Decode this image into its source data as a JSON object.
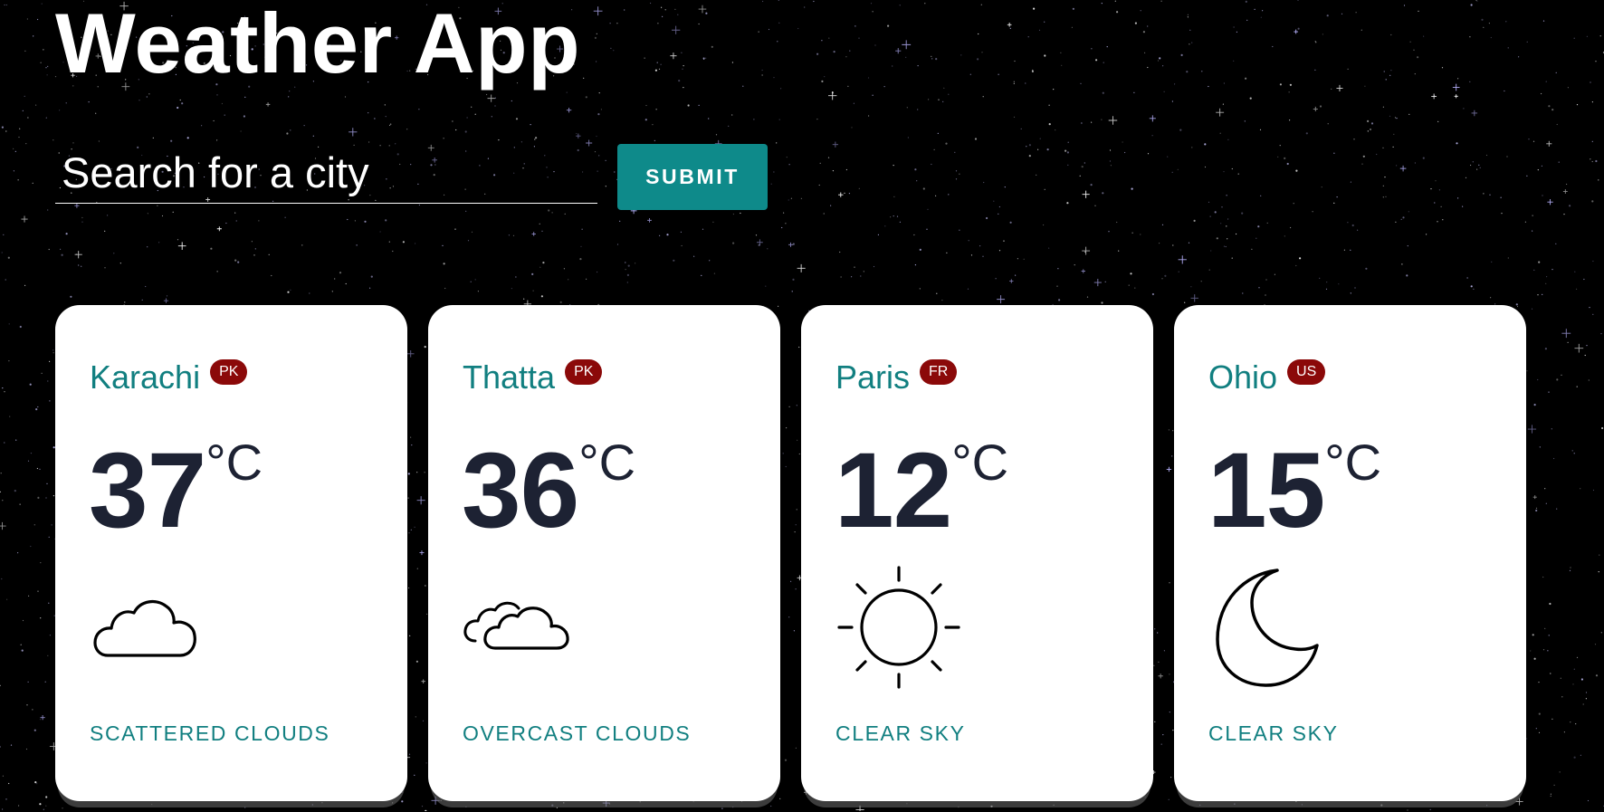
{
  "app": {
    "title": "Weather App"
  },
  "search": {
    "placeholder": "Search for a city",
    "value": "",
    "submit_label": "SUBMIT"
  },
  "colors": {
    "background": "#000000",
    "accent": "#0e8a8a",
    "city_text": "#117f80",
    "badge": "#8b0909",
    "temperature_text": "#1d2233",
    "card": "#ffffff"
  },
  "cards": [
    {
      "city": "Karachi",
      "country": "PK",
      "temperature": "37",
      "unit": "°C",
      "icon": "cloud-icon",
      "description": "SCATTERED CLOUDS"
    },
    {
      "city": "Thatta",
      "country": "PK",
      "temperature": "36",
      "unit": "°C",
      "icon": "overcast-clouds-icon",
      "description": "OVERCAST CLOUDS"
    },
    {
      "city": "Paris",
      "country": "FR",
      "temperature": "12",
      "unit": "°C",
      "icon": "sun-icon",
      "description": "CLEAR SKY"
    },
    {
      "city": "Ohio",
      "country": "US",
      "temperature": "15",
      "unit": "°C",
      "icon": "moon-icon",
      "description": "CLEAR SKY"
    }
  ]
}
